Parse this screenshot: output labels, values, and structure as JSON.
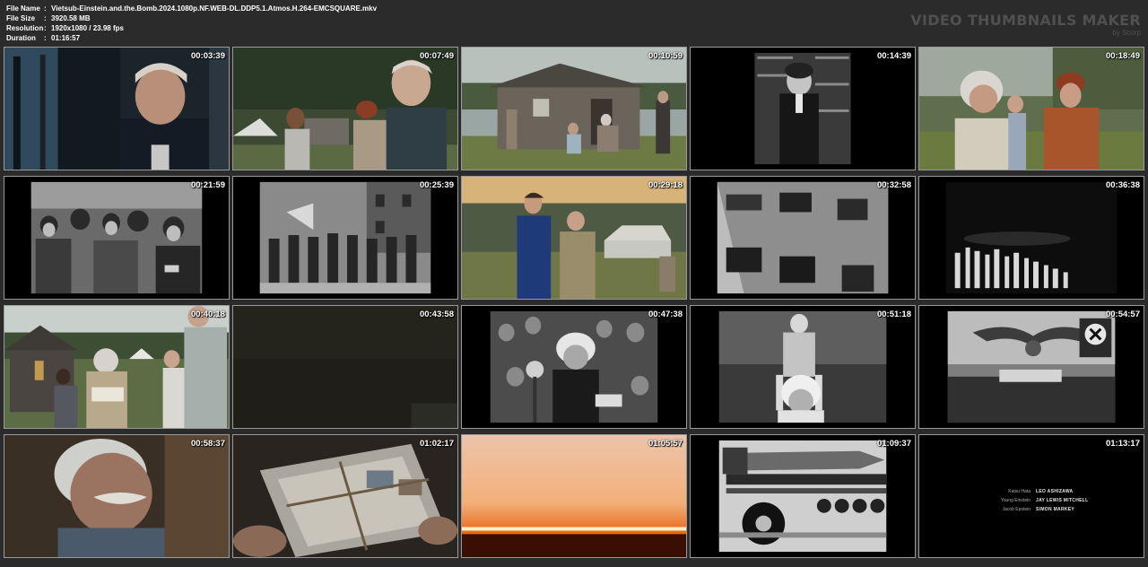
{
  "file_info": [
    {
      "label": "File Name",
      "value": "Vietsub-Einstein.and.the.Bomb.2024.1080p.NF.WEB-DL.DDP5.1.Atmos.H.264-EMCSQUARE.mkv"
    },
    {
      "label": "File Size",
      "value": "3920.58 MB"
    },
    {
      "label": "Resolution",
      "value": "1920x1080 / 23.98 fps"
    },
    {
      "label": "Duration",
      "value": "01:16:57"
    }
  ],
  "info_separator": ":",
  "brand": {
    "title": "VIDEO THUMBNAILS MAKER",
    "byline": "by Scorp"
  },
  "thumbnails": [
    {
      "time": "00:03:39",
      "scene": "portrait-man-dark-interior"
    },
    {
      "time": "00:07:49",
      "scene": "camp-couple-and-man"
    },
    {
      "time": "00:10:59",
      "scene": "wooden-hut-people-seated"
    },
    {
      "time": "00:14:39",
      "scene": "archival-einstein-bookshelf"
    },
    {
      "time": "00:18:49",
      "scene": "einstein-women-outdoors"
    },
    {
      "time": "00:21:59",
      "scene": "archival-crowd"
    },
    {
      "time": "00:25:39",
      "scene": "archival-march-flags"
    },
    {
      "time": "00:29:18",
      "scene": "young-einstein-field-tents"
    },
    {
      "time": "00:32:58",
      "scene": "archival-building-windows"
    },
    {
      "time": "00:36:38",
      "scene": "archival-rally-night"
    },
    {
      "time": "00:40:18",
      "scene": "hut-einstein-reading-letter"
    },
    {
      "time": "00:43:58",
      "scene": "dark-scene"
    },
    {
      "time": "00:47:38",
      "scene": "archival-einstein-microphone"
    },
    {
      "time": "00:51:18",
      "scene": "archival-einstein-child"
    },
    {
      "time": "00:54:57",
      "scene": "archival-eagle-assembly"
    },
    {
      "time": "00:58:37",
      "scene": "einstein-closeup"
    },
    {
      "time": "01:02:17",
      "scene": "bundle-of-letters"
    },
    {
      "time": "01:05:57",
      "scene": "sunset-horizon"
    },
    {
      "time": "01:09:37",
      "scene": "archival-rocket-trailer"
    },
    {
      "time": "01:13:17",
      "scene": "end-credits"
    }
  ],
  "credits": [
    {
      "role": "Katsu Hata",
      "name": "LEO ASHIZAWA"
    },
    {
      "role": "Young Einstein",
      "name": "JAY LEWIS MITCHELL"
    },
    {
      "role": "Jacob Epstein",
      "name": "SIMON MARKEY"
    }
  ],
  "colors": {
    "background": "#2b2b2b",
    "tile_border": "#9a9a9a",
    "text": "#ffffff",
    "brand": "#505050"
  }
}
